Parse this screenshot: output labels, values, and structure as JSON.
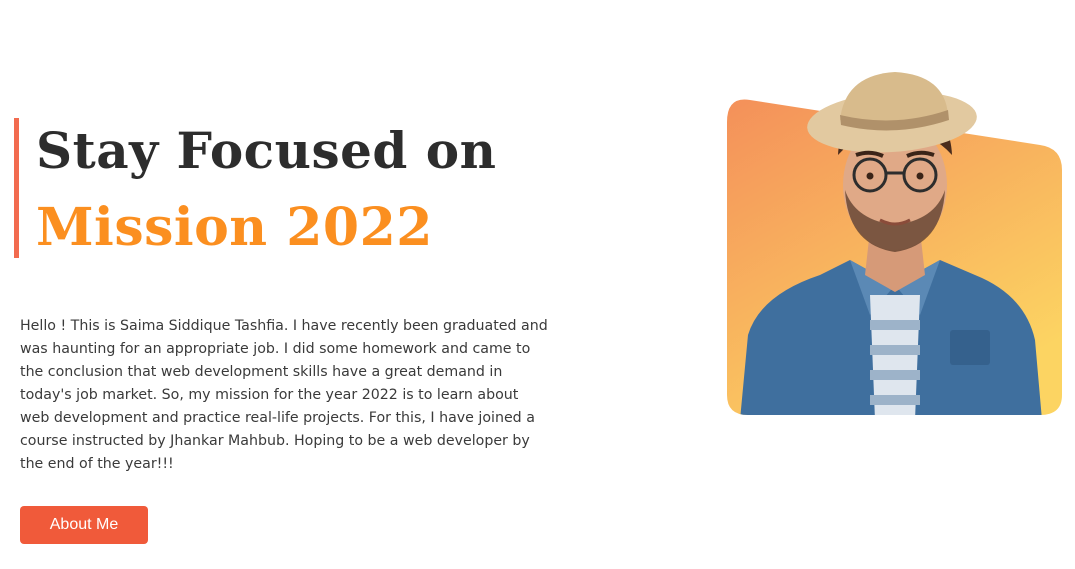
{
  "hero": {
    "title_line1": "Stay Focused on",
    "title_line2": "Mission 2022",
    "bio": "Hello ! This is Saima Siddique Tashfia. I have recently been graduated and was haunting for an appropriate job. I did some homework and came to the conclusion that web development skills have a great demand in today's job market. So, my mission for the year 2022 is to learn about web development and practice real-life projects. For this, I have joined a course instructed by Jhankar Mahbub. Hoping to be a web developer by the end of the year!!!",
    "button_label": "About Me"
  },
  "colors": {
    "accent_bar": "#f26b4f",
    "title_dark": "#2d2d2d",
    "title_orange": "#fb8f20",
    "button_bg": "#f05a3a",
    "image_bg_top": "#f4905a",
    "image_bg_bottom": "#fcd462"
  }
}
